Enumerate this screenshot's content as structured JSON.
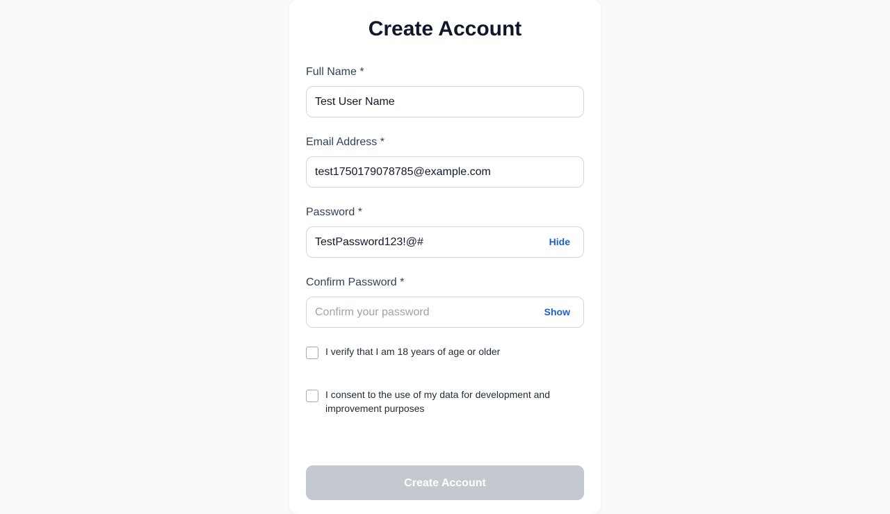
{
  "form": {
    "title": "Create Account",
    "full_name": {
      "label": "Full Name *",
      "value": "Test User Name"
    },
    "email": {
      "label": "Email Address *",
      "value": "test1750179078785@example.com"
    },
    "password": {
      "label": "Password *",
      "value": "TestPassword123!@#",
      "toggle_label": "Hide"
    },
    "confirm_password": {
      "label": "Confirm Password *",
      "placeholder": "Confirm your password",
      "toggle_label": "Show"
    },
    "age_checkbox": {
      "label": "I verify that I am 18 years of age or older",
      "checked": false
    },
    "consent_checkbox": {
      "label": "I consent to the use of my data for development and improvement purposes",
      "checked": false
    },
    "submit_label": "Create Account"
  },
  "colors": {
    "page_background": "#f8fafc",
    "link": "#1d5fd1",
    "button_disabled": "#c4c8cf",
    "title": "#0f172a"
  }
}
